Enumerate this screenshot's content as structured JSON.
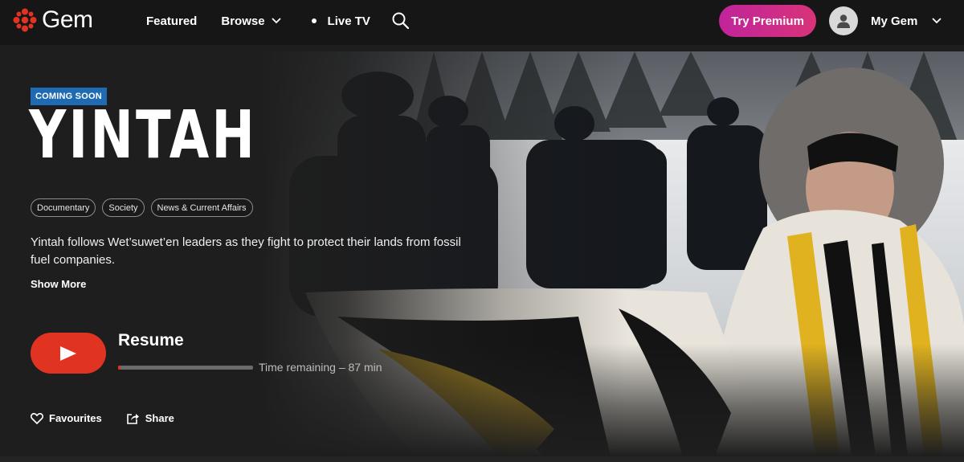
{
  "header": {
    "logo_text": "Gem",
    "nav": {
      "featured": "Featured",
      "browse": "Browse",
      "live_tv": "Live TV"
    },
    "premium_button": "Try Premium",
    "account_label": "My Gem",
    "icons": [
      "cbc-gem-logo-icon",
      "chevron-down-icon",
      "live-dot-icon",
      "search-icon",
      "user-avatar-icon"
    ]
  },
  "hero": {
    "badge": "COMING SOON",
    "title": "YINTAH",
    "tags": [
      "Documentary",
      "Society",
      "News & Current Affairs"
    ],
    "description": "Yintah follows Wet’suwet’en leaders as they fight to protect their lands from fossil fuel companies.",
    "show_more": "Show More",
    "resume_label": "Resume",
    "progress_fraction": 0.02,
    "time_remaining": "Time remaining – 87 min",
    "actions": {
      "favourites": "Favourites",
      "share": "Share"
    }
  },
  "colors": {
    "brand_red": "#e03321",
    "premium_gradient_start": "#c0249a",
    "premium_gradient_end": "#d8337a",
    "badge_blue": "#1f6bb3",
    "background": "#1e1e1e"
  }
}
